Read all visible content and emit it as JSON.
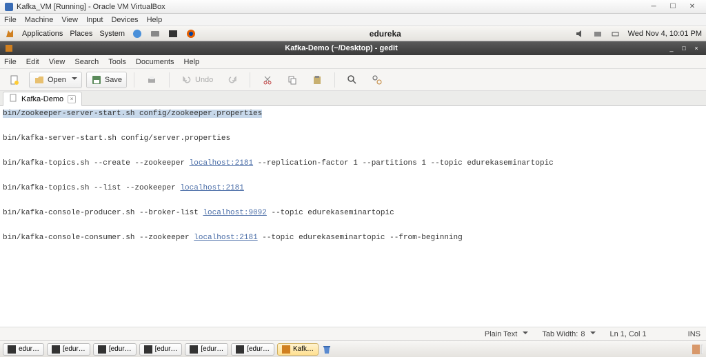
{
  "vbox": {
    "title": "Kafka_VM [Running] - Oracle VM VirtualBox",
    "menu": [
      "File",
      "Machine",
      "View",
      "Input",
      "Devices",
      "Help"
    ]
  },
  "gnome": {
    "apps": "Applications",
    "places": "Places",
    "system": "System",
    "center": "edureka",
    "datetime": "Wed Nov  4, 10:01 PM"
  },
  "gedit": {
    "title": "Kafka-Demo (~/Desktop) - gedit",
    "menu": [
      "File",
      "Edit",
      "View",
      "Search",
      "Tools",
      "Documents",
      "Help"
    ],
    "toolbar": {
      "open": "Open",
      "save": "Save",
      "undo": "Undo"
    },
    "tab": "Kafka-Demo",
    "lines": [
      "bin/zookeeper-server-start.sh config/zookeeper.properties",
      "",
      "bin/kafka-server-start.sh config/server.properties",
      "",
      "bin/kafka-topics.sh --create --zookeeper localhost:2181 --replication-factor 1 --partitions 1 --topic edurekaseminartopic",
      "",
      "bin/kafka-topics.sh --list --zookeeper localhost:2181",
      "",
      "bin/kafka-console-producer.sh --broker-list localhost:9092 --topic edurekaseminartopic",
      "",
      "bin/kafka-console-consumer.sh --zookeeper localhost:2181 --topic edurekaseminartopic --from-beginning"
    ],
    "status": {
      "syntax": "Plain Text",
      "tabwidth_label": "Tab Width:",
      "tabwidth_value": "8",
      "cursor": "Ln 1, Col 1",
      "mode": "INS"
    }
  },
  "taskbar": {
    "items": [
      {
        "label": "edur…",
        "active": false
      },
      {
        "label": "[edur…",
        "active": false
      },
      {
        "label": "[edur…",
        "active": false
      },
      {
        "label": "[edur…",
        "active": false
      },
      {
        "label": "[edur…",
        "active": false
      },
      {
        "label": "[edur…",
        "active": false
      },
      {
        "label": "Kafk…",
        "active": true
      }
    ]
  }
}
